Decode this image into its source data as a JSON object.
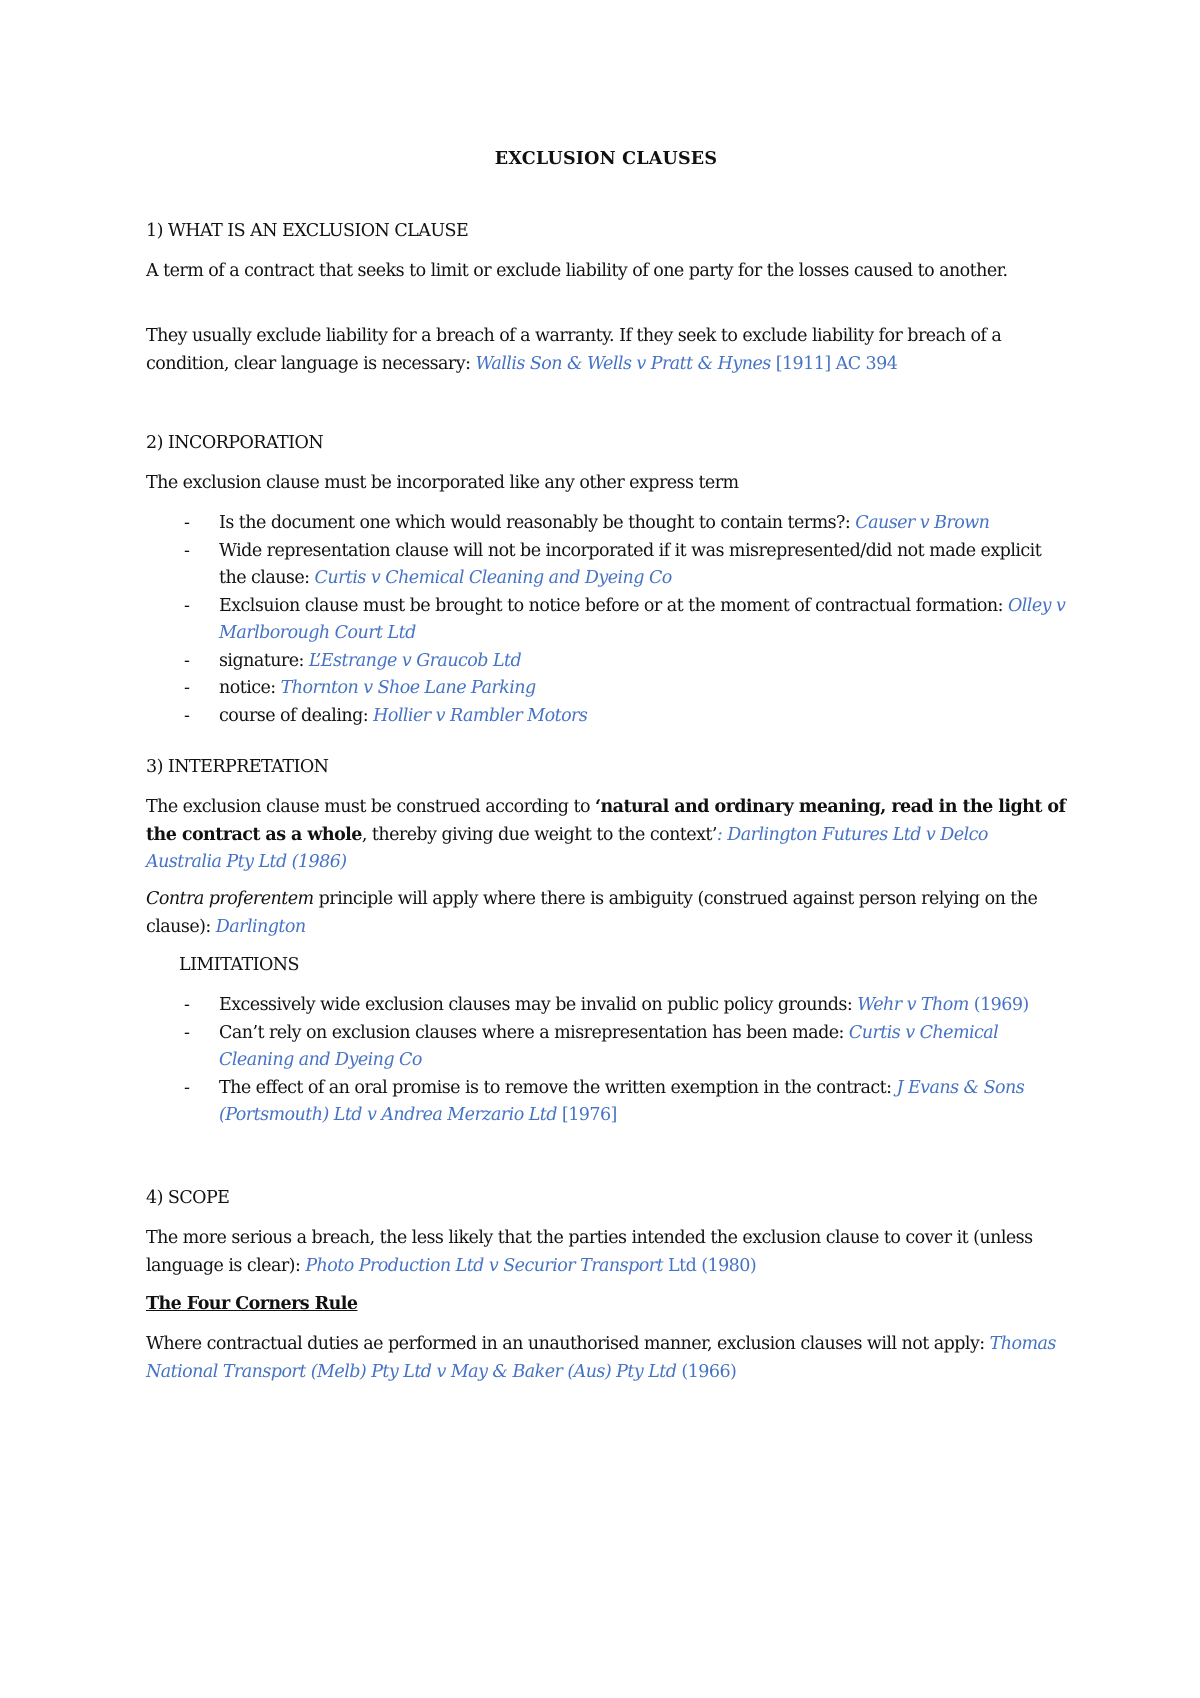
{
  "document": {
    "title": "EXCLUSION CLAUSES",
    "link_color": "#4472c4",
    "sections": {
      "s1": {
        "heading": "1) WHAT IS AN EXCLUSION CLAUSE",
        "p1": "A term of a contract that seeks to limit or exclude liability of one party for the losses caused to another.",
        "p2_text": "They usually exclude liability for a breach of a warranty. If they seek to exclude liability for breach of a condition, clear language is necessary: ",
        "p2_case": "Wallis Son & Wells v Pratt & Hynes",
        "p2_cite": " [1911] AC 394"
      },
      "s2": {
        "heading": "2) INCORPORATION",
        "intro": "The exclusion clause must be incorporated like any other express term",
        "bullets": [
          {
            "text": "Is the document one which would reasonably be thought to contain terms?: ",
            "case": "Causer v Brown"
          },
          {
            "text": "Wide representation clause will not be incorporated if it was misrepresented/did not made explicit the clause: ",
            "case": "Curtis v Chemical Cleaning and Dyeing Co"
          },
          {
            "text": "Exclsuion clause must be brought to notice before or at the moment of contractual formation: ",
            "case": "Olley v Marlborough Court Ltd"
          },
          {
            "text": "signature: ",
            "case": "L’Estrange v Graucob Ltd"
          },
          {
            "text": "notice: ",
            "case": "Thornton v Shoe Lane Parking"
          },
          {
            "text": "course of dealing: ",
            "case": "Hollier v Rambler Motors"
          }
        ]
      },
      "s3": {
        "heading": "3) INTERPRETATION",
        "p1_text": "The exclusion clause must be construed according to ",
        "p1_bold": "‘natural and ordinary meaning, read in the light of the contract as a whole",
        "p1_after": ", thereby giving due weight to the context’",
        "p1_case": ": Darlington Futures Ltd v Delco Australia Pty Ltd (1986)",
        "p2_italic": "Contra proferentem",
        "p2_text": " principle will apply where there is ambiguity (construed against person relying on the clause): ",
        "p2_case": "Darlington",
        "limitations_heading": "LIMITATIONS",
        "limitations": [
          {
            "text": "Excessively wide exclusion clauses may be invalid on public policy grounds: ",
            "case": "Wehr v Thom",
            "cite": " (1969)"
          },
          {
            "text": "Can’t rely on exclusion clauses where a misrepresentation has been made: ",
            "case": "Curtis v Chemical Cleaning and Dyeing Co",
            "cite": ""
          },
          {
            "text": "The effect of an oral promise is to remove the written exemption in the contract: ",
            "case": "J Evans & Sons (Portsmouth) Ltd v Andrea Merzario Ltd",
            "cite": " [1976]"
          }
        ]
      },
      "s4": {
        "heading": "4) SCOPE",
        "p1_text": "The more serious a breach, the less likely that the parties intended the exclusion clause to cover it (unless language is clear): ",
        "p1_case": "Photo Production Ltd v Securior Transport",
        "p1_cite": " Ltd (1980)",
        "subheading": "The Four Corners Rule",
        "p2_text": "Where contractual duties ae performed in an unauthorised manner, exclusion clauses will not apply: ",
        "p2_case": "Thomas National Transport (Melb) Pty Ltd v May & Baker (Aus) Pty Ltd",
        "p2_cite": " (1966)"
      }
    },
    "bullet_glyph": "-"
  }
}
